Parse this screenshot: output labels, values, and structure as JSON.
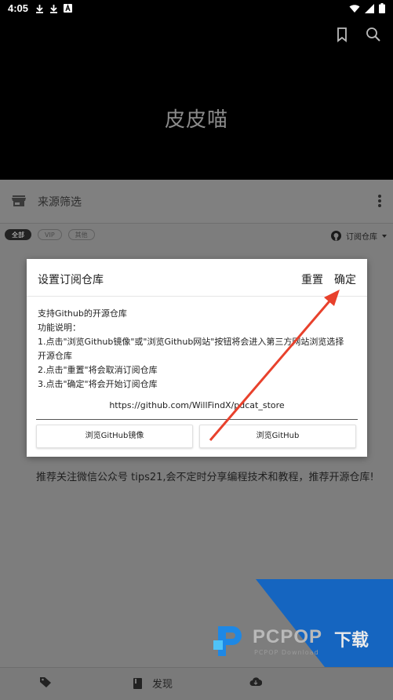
{
  "status_bar": {
    "time": "4:05",
    "left_icons": [
      "download-icon",
      "download-icon",
      "a-box-icon"
    ],
    "right_icons": [
      "wifi-icon",
      "signal-icon",
      "battery-icon"
    ]
  },
  "header": {
    "app_title": "皮皮喵",
    "actions": [
      "bookmark-icon",
      "search-icon"
    ]
  },
  "filter": {
    "label": "来源筛选",
    "chips": [
      "全部",
      "VIP",
      "其他"
    ],
    "active_chip": "全部",
    "subscribe_label": "订阅仓库"
  },
  "dialog": {
    "title": "设置订阅仓库",
    "reset_label": "重置",
    "ok_label": "确定",
    "body_lines": [
      "支持Github的开源仓库",
      "功能说明：",
      "1.点击\"浏览Github镜像\"或\"浏览Github网站\"按钮将会进入第三方网站浏览选择",
      "开源仓库",
      "2.点击\"重置\"将会取消订阅仓库",
      "3.点击\"确定\"将会开始订阅仓库"
    ],
    "url": "https://github.com/WillFindX/pdcat_store",
    "mirror_button": "浏览GitHub镜像",
    "github_button": "浏览GitHub"
  },
  "promo_text": "推荐关注微信公众号 tips21,会不定时分享编程技术和教程，推荐开源仓库!",
  "watermark": {
    "brand": "PCPOP",
    "brand_suffix": "下载",
    "sub": "PCPOP Download"
  },
  "bottom_nav": {
    "items": [
      "",
      "发现",
      ""
    ]
  },
  "colors": {
    "arrow": "#e8412c",
    "watermark_blue": "#1565c0"
  }
}
